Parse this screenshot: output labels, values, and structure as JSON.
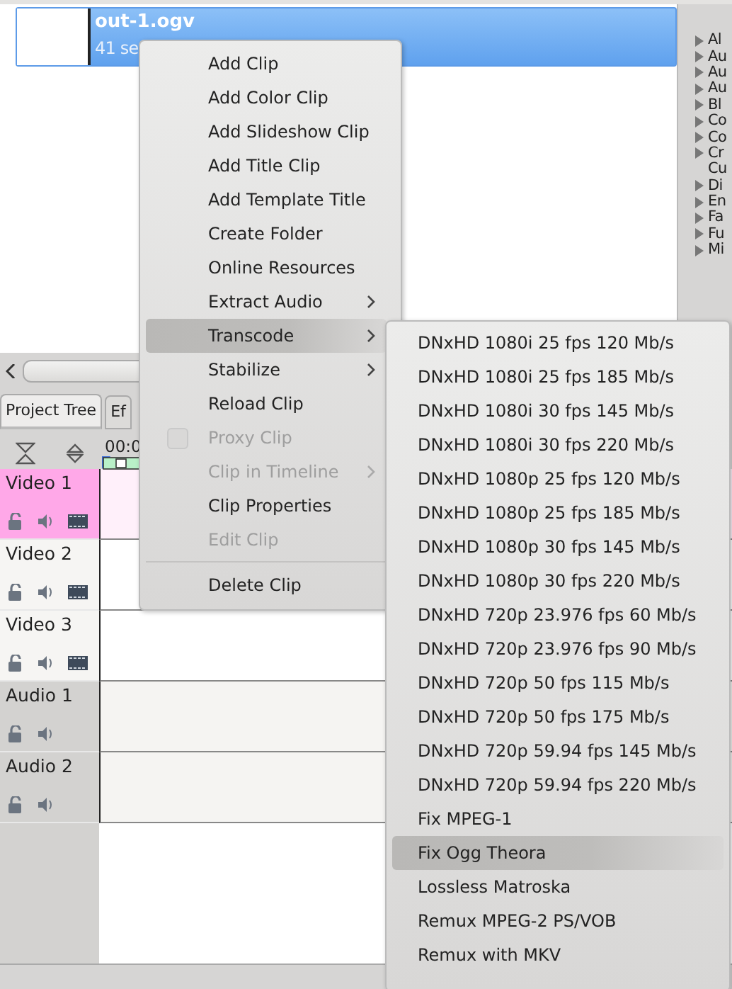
{
  "clips": [
    {
      "name": "out-1.ogv",
      "duration": "41 se",
      "selected": true
    }
  ],
  "effects": [
    {
      "label": "Al",
      "expandable": true
    },
    {
      "label": "Au",
      "expandable": true
    },
    {
      "label": "Au",
      "expandable": true
    },
    {
      "label": "Au",
      "expandable": true
    },
    {
      "label": "Bl",
      "expandable": true
    },
    {
      "label": "Co",
      "expandable": true
    },
    {
      "label": "Co",
      "expandable": true
    },
    {
      "label": "Cr",
      "expandable": true
    },
    {
      "label": "Cu",
      "expandable": false
    },
    {
      "label": "Di",
      "expandable": true
    },
    {
      "label": "En",
      "expandable": true
    },
    {
      "label": "Fa",
      "expandable": true
    },
    {
      "label": "Fu",
      "expandable": true
    },
    {
      "label": "Mi",
      "expandable": true
    }
  ],
  "tabs": [
    {
      "label": "Project Tree",
      "selected": true
    },
    {
      "label": "Ef",
      "selected": false
    }
  ],
  "timeline": {
    "timecode": "00:0",
    "tracks": [
      {
        "name": "Video 1",
        "kind": "video",
        "selected": true
      },
      {
        "name": "Video 2",
        "kind": "video",
        "selected": false
      },
      {
        "name": "Video 3",
        "kind": "video",
        "selected": false
      },
      {
        "name": "Audio 1",
        "kind": "audio",
        "selected": false
      },
      {
        "name": "Audio 2",
        "kind": "audio",
        "selected": false
      }
    ]
  },
  "context_menu": {
    "items": [
      {
        "kind": "item",
        "label": "Add Clip",
        "disabled": false,
        "selected": false
      },
      {
        "kind": "item",
        "label": "Add Color Clip",
        "disabled": false,
        "selected": false
      },
      {
        "kind": "item",
        "label": "Add Slideshow Clip",
        "disabled": false,
        "selected": false
      },
      {
        "kind": "item",
        "label": "Add Title Clip",
        "disabled": false,
        "selected": false
      },
      {
        "kind": "item",
        "label": "Add Template Title",
        "disabled": false,
        "selected": false
      },
      {
        "kind": "item",
        "label": "Create Folder",
        "disabled": false,
        "selected": false
      },
      {
        "kind": "item",
        "label": "Online Resources",
        "disabled": false,
        "selected": false
      },
      {
        "kind": "submenu",
        "label": "Extract Audio",
        "disabled": false,
        "selected": false
      },
      {
        "kind": "submenu",
        "label": "Transcode",
        "disabled": false,
        "selected": true
      },
      {
        "kind": "submenu",
        "label": "Stabilize",
        "disabled": false,
        "selected": false
      },
      {
        "kind": "item",
        "label": "Reload Clip",
        "disabled": false,
        "selected": false
      },
      {
        "kind": "check",
        "label": "Proxy Clip",
        "disabled": true,
        "selected": false,
        "checked": false
      },
      {
        "kind": "submenu",
        "label": "Clip in Timeline",
        "disabled": true,
        "selected": false
      },
      {
        "kind": "item",
        "label": "Clip Properties",
        "disabled": false,
        "selected": false
      },
      {
        "kind": "item",
        "label": "Edit Clip",
        "disabled": true,
        "selected": false
      },
      {
        "kind": "separator"
      },
      {
        "kind": "item",
        "label": "Delete Clip",
        "disabled": false,
        "selected": false
      }
    ]
  },
  "submenu": {
    "items": [
      {
        "label": "DNxHD 1080i 25 fps 120 Mb/s",
        "selected": false
      },
      {
        "label": "DNxHD 1080i 25 fps 185 Mb/s",
        "selected": false
      },
      {
        "label": "DNxHD 1080i 30 fps 145 Mb/s",
        "selected": false
      },
      {
        "label": "DNxHD 1080i 30 fps 220 Mb/s",
        "selected": false
      },
      {
        "label": "DNxHD 1080p 25 fps 120 Mb/s",
        "selected": false
      },
      {
        "label": "DNxHD 1080p 25 fps 185 Mb/s",
        "selected": false
      },
      {
        "label": "DNxHD 1080p 30 fps 145 Mb/s",
        "selected": false
      },
      {
        "label": "DNxHD 1080p 30 fps 220 Mb/s",
        "selected": false
      },
      {
        "label": "DNxHD 720p 23.976 fps 60 Mb/s",
        "selected": false
      },
      {
        "label": "DNxHD 720p 23.976 fps 90 Mb/s",
        "selected": false
      },
      {
        "label": "DNxHD 720p 50 fps 115 Mb/s",
        "selected": false
      },
      {
        "label": "DNxHD 720p 50 fps 175 Mb/s",
        "selected": false
      },
      {
        "label": "DNxHD 720p 59.94 fps 145 Mb/s",
        "selected": false
      },
      {
        "label": "DNxHD 720p 59.94 fps 220 Mb/s",
        "selected": false
      },
      {
        "label": "Fix MPEG-1",
        "selected": false
      },
      {
        "label": "Fix Ogg Theora",
        "selected": true
      },
      {
        "label": "Lossless Matroska",
        "selected": false
      },
      {
        "label": "Remux MPEG-2 PS/VOB",
        "selected": false
      },
      {
        "label": "Remux with MKV",
        "selected": false
      }
    ]
  }
}
